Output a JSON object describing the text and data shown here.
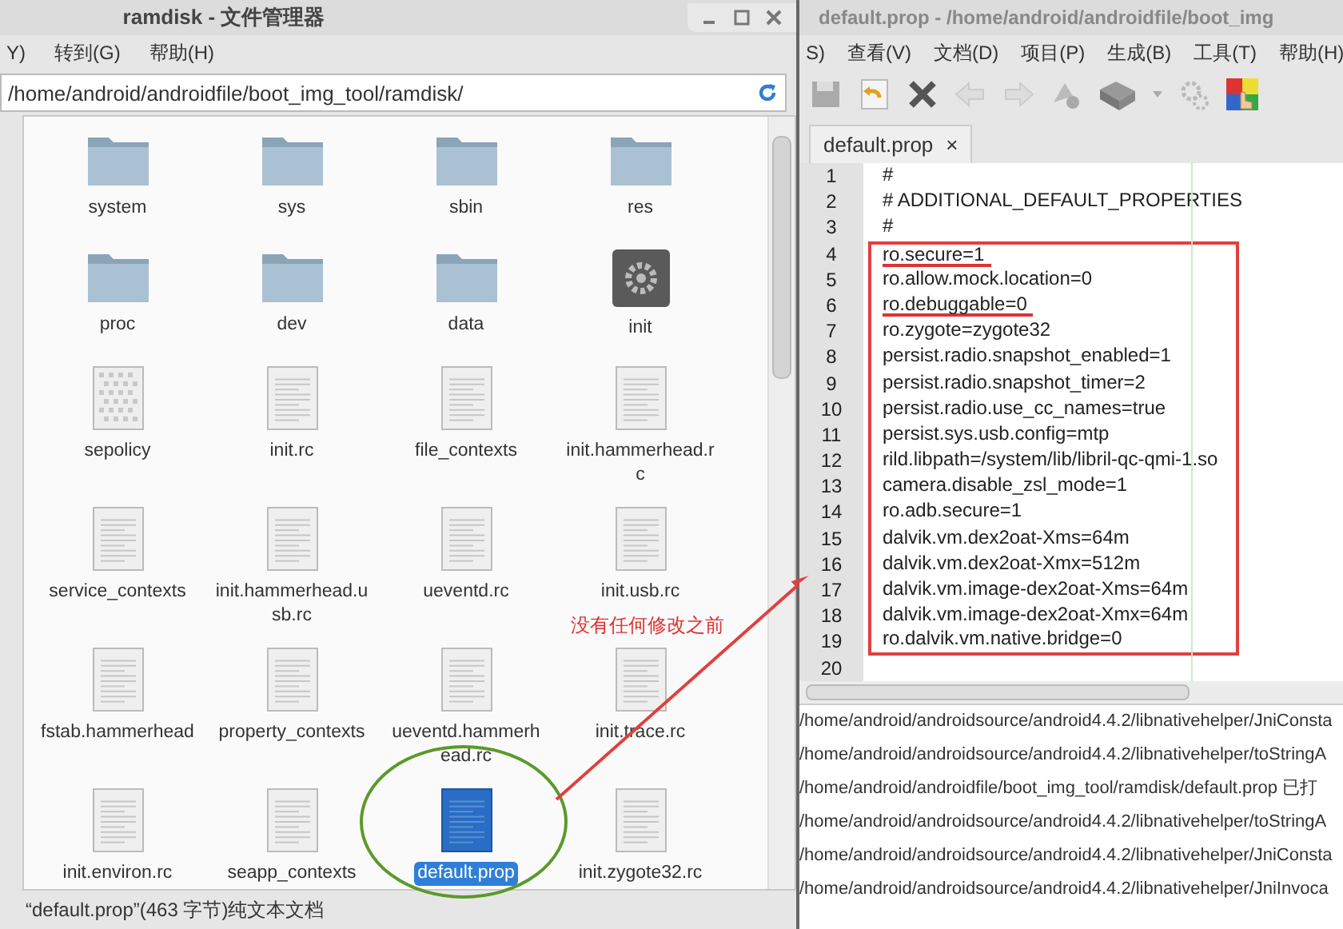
{
  "file_manager": {
    "title": "ramdisk - 文件管理器",
    "menu": [
      "Y)",
      "转到(G)",
      "帮助(H)"
    ],
    "path": "/home/android/androidfile/boot_img_tool/ramdisk/",
    "files": [
      {
        "name": "system",
        "kind": "folder",
        "selected": false
      },
      {
        "name": "sys",
        "kind": "folder",
        "selected": false
      },
      {
        "name": "sbin",
        "kind": "folder",
        "selected": false
      },
      {
        "name": "res",
        "kind": "folder",
        "selected": false
      },
      {
        "name": "proc",
        "kind": "folder",
        "selected": false
      },
      {
        "name": "dev",
        "kind": "folder",
        "selected": false
      },
      {
        "name": "data",
        "kind": "folder",
        "selected": false
      },
      {
        "name": "init",
        "kind": "executable",
        "selected": false
      },
      {
        "name": "sepolicy",
        "kind": "binary",
        "selected": false
      },
      {
        "name": "init.rc",
        "kind": "text",
        "selected": false
      },
      {
        "name": "file_contexts",
        "kind": "text",
        "selected": false
      },
      {
        "name": "init.hammerhead.rc",
        "kind": "text",
        "selected": false
      },
      {
        "name": "service_contexts",
        "kind": "text",
        "selected": false
      },
      {
        "name": "init.hammerhead.usb.rc",
        "kind": "text",
        "selected": false
      },
      {
        "name": "ueventd.rc",
        "kind": "text",
        "selected": false
      },
      {
        "name": "init.usb.rc",
        "kind": "text",
        "selected": false
      },
      {
        "name": "fstab.hammerhead",
        "kind": "text",
        "selected": false
      },
      {
        "name": "property_contexts",
        "kind": "text",
        "selected": false
      },
      {
        "name": "ueventd.hammerhead.rc",
        "kind": "text",
        "selected": false
      },
      {
        "name": "init.trace.rc",
        "kind": "text",
        "selected": false
      },
      {
        "name": "init.environ.rc",
        "kind": "text",
        "selected": false
      },
      {
        "name": "seapp_contexts",
        "kind": "text",
        "selected": false
      },
      {
        "name": "default.prop",
        "kind": "text",
        "selected": true
      },
      {
        "name": "init.zygote32.rc",
        "kind": "text",
        "selected": false
      }
    ],
    "status": "“default.prop”(463 字节)纯文本文档"
  },
  "editor": {
    "title": "default.prop - /home/android/androidfile/boot_img",
    "menu": [
      "S)",
      "查看(V)",
      "文档(D)",
      "项目(P)",
      "生成(B)",
      "工具(T)",
      "帮助(H)"
    ],
    "tabs": [
      {
        "label": "default.prop",
        "close": "×",
        "selected": true
      }
    ],
    "lines": [
      {
        "number": "1",
        "text": "#",
        "boxed": false,
        "underlined": false
      },
      {
        "number": "2",
        "text": "# ADDITIONAL_DEFAULT_PROPERTIES",
        "boxed": false,
        "underlined": false
      },
      {
        "number": "3",
        "text": "#",
        "boxed": false,
        "underlined": false
      },
      {
        "number": "4",
        "text": "ro.secure=1",
        "boxed": true,
        "underlined": true
      },
      {
        "number": "5",
        "text": "ro.allow.mock.location=0",
        "boxed": true,
        "underlined": false
      },
      {
        "number": "6",
        "text": "ro.debuggable=0",
        "boxed": true,
        "underlined": true
      },
      {
        "number": "7",
        "text": "ro.zygote=zygote32",
        "boxed": true,
        "underlined": false
      },
      {
        "number": "8",
        "text": "persist.radio.snapshot_enabled=1",
        "boxed": true,
        "underlined": false
      },
      {
        "number": "9",
        "text": "persist.radio.snapshot_timer=2",
        "boxed": true,
        "underlined": false
      },
      {
        "number": "10",
        "text": "persist.radio.use_cc_names=true",
        "boxed": true,
        "underlined": false
      },
      {
        "number": "11",
        "text": "persist.sys.usb.config=mtp",
        "boxed": true,
        "underlined": false
      },
      {
        "number": "12",
        "text": "rild.libpath=/system/lib/libril-qc-qmi-1.so",
        "boxed": true,
        "underlined": false
      },
      {
        "number": "13",
        "text": "camera.disable_zsl_mode=1",
        "boxed": true,
        "underlined": false
      },
      {
        "number": "14",
        "text": "ro.adb.secure=1",
        "boxed": true,
        "underlined": false
      },
      {
        "number": "15",
        "text": "dalvik.vm.dex2oat-Xms=64m",
        "boxed": true,
        "underlined": false
      },
      {
        "number": "16",
        "text": "dalvik.vm.dex2oat-Xmx=512m",
        "boxed": true,
        "underlined": false
      },
      {
        "number": "17",
        "text": "dalvik.vm.image-dex2oat-Xms=64m",
        "boxed": true,
        "underlined": false
      },
      {
        "number": "18",
        "text": "dalvik.vm.image-dex2oat-Xmx=64m",
        "boxed": true,
        "underlined": false
      },
      {
        "number": "19",
        "text": "ro.dalvik.vm.native.bridge=0",
        "boxed": true,
        "underlined": false
      },
      {
        "number": "20",
        "boxed": false
      }
    ],
    "messages": [
      "/home/android/androidsource/android4.4.2/libnativehelper/JniConsta",
      "/home/android/androidsource/android4.4.2/libnativehelper/toStringA",
      "/home/android/androidfile/boot_img_tool/ramdisk/default.prop 已打",
      "/home/android/androidsource/android4.4.2/libnativehelper/toStringA",
      "/home/android/androidsource/android4.4.2/libnativehelper/JniConsta",
      "/home/android/androidsource/android4.4.2/libnativehelper/JniInvoca"
    ]
  },
  "annotation": {
    "note": "没有任何修改之前"
  }
}
